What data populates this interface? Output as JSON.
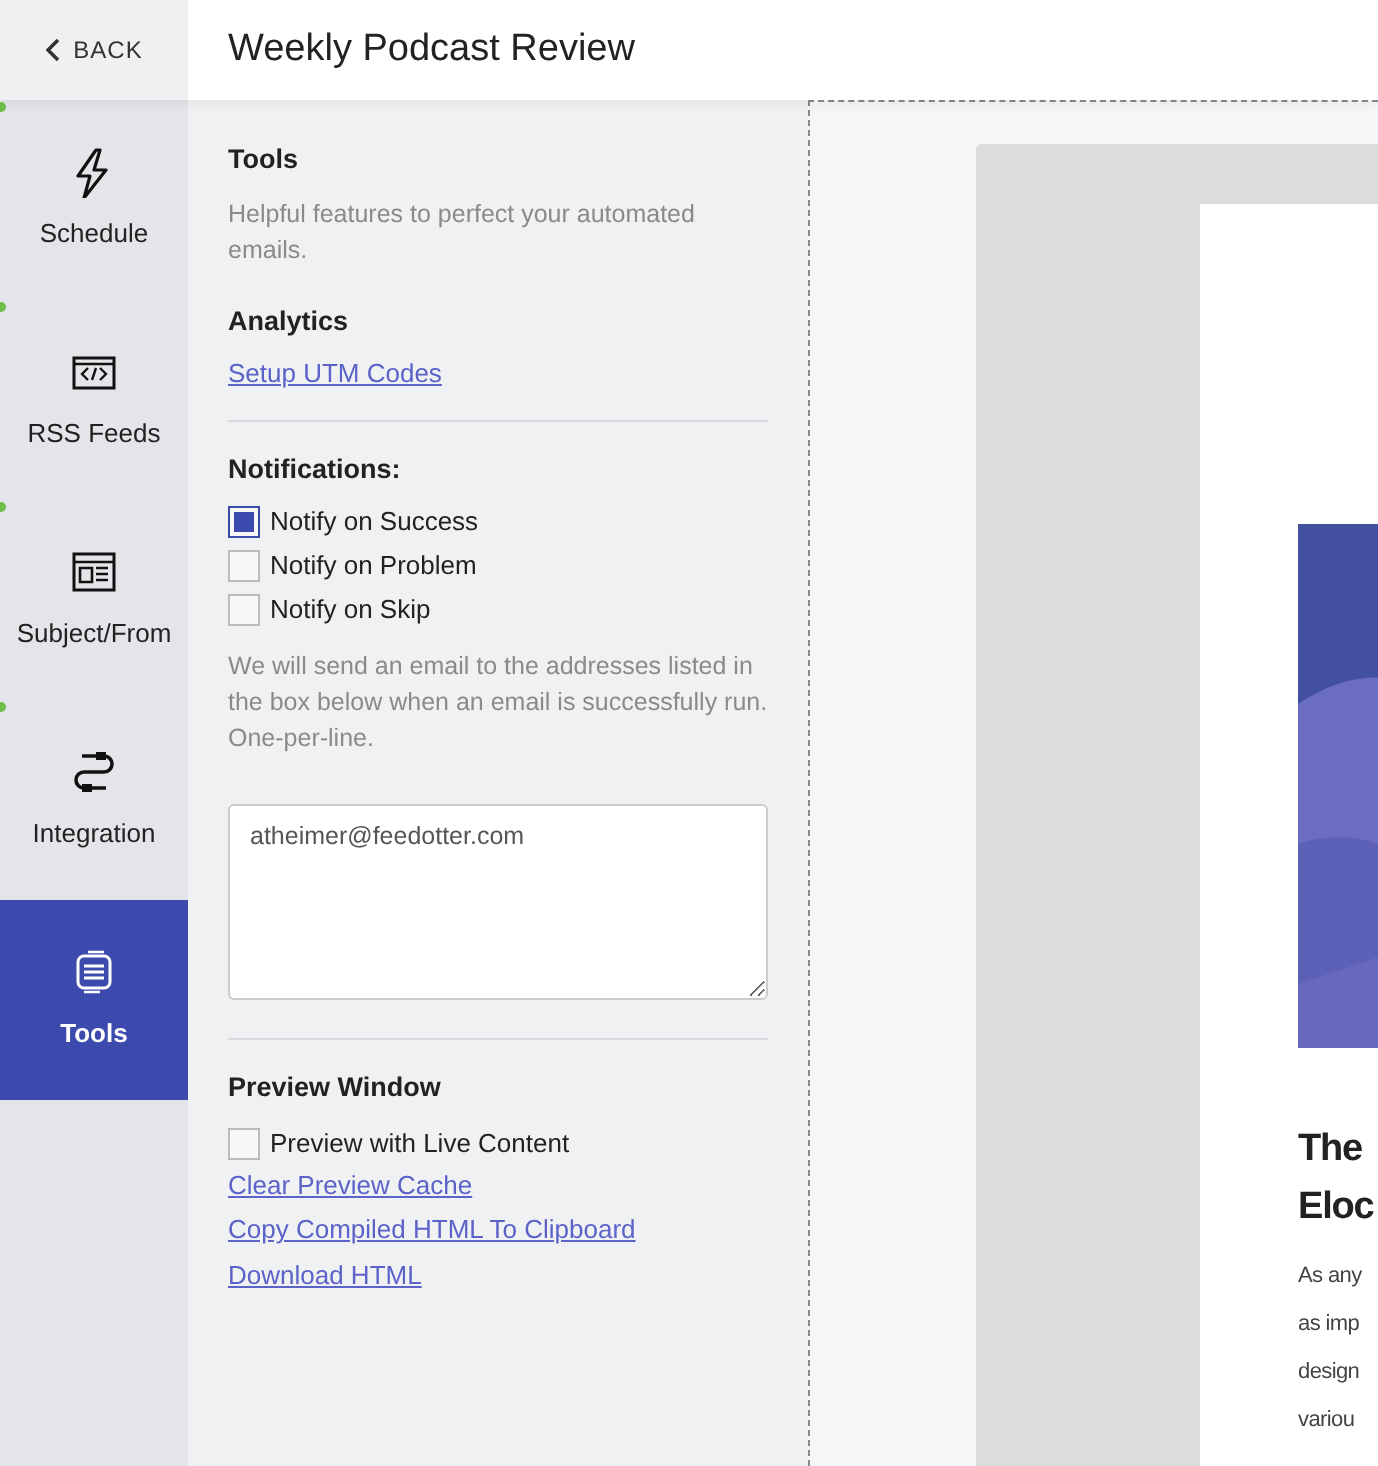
{
  "header": {
    "back": "BACK",
    "title": "Weekly Podcast Review"
  },
  "nav": [
    {
      "label": "Schedule",
      "completed": true,
      "selected": false
    },
    {
      "label": "RSS Feeds",
      "completed": true,
      "selected": false
    },
    {
      "label": "Subject/From",
      "completed": true,
      "selected": false
    },
    {
      "label": "Integration",
      "completed": true,
      "selected": false
    },
    {
      "label": "Tools",
      "completed": false,
      "selected": true
    }
  ],
  "tools": {
    "title": "Tools",
    "description": "Helpful features to perfect your automated emails.",
    "analytics": {
      "heading": "Analytics",
      "link": "Setup UTM Codes"
    },
    "notifications": {
      "heading": "Notifications:",
      "options": [
        {
          "label": "Notify on Success",
          "checked": true
        },
        {
          "label": "Notify on Problem",
          "checked": false
        },
        {
          "label": "Notify on Skip",
          "checked": false
        }
      ],
      "help": "We will send an email to the addresses listed in the box below when an email is successfully run. One-per-line.",
      "emails": "atheimer@feedotter.com"
    },
    "preview": {
      "heading": "Preview Window",
      "options": [
        {
          "label": "Preview with Live Content",
          "checked": false
        }
      ],
      "links": [
        "Clear Preview Cache",
        "Copy Compiled HTML To Clipboard",
        "Download HTML"
      ]
    }
  },
  "email_preview": {
    "image": {
      "kind": "picture"
    },
    "headline": [
      "The",
      "Eloc"
    ],
    "body": [
      "As any",
      "as imp",
      "design",
      "variou"
    ]
  }
}
